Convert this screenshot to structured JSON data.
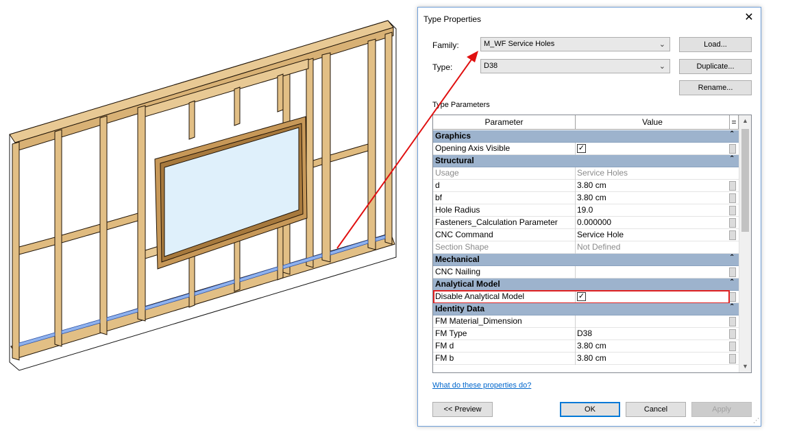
{
  "dialog": {
    "title": "Type Properties",
    "family_label": "Family:",
    "family_value": "M_WF Service Holes",
    "type_label": "Type:",
    "type_value": "D38",
    "load_button": "Load...",
    "duplicate_button": "Duplicate...",
    "rename_button": "Rename...",
    "type_parameters_label": "Type Parameters",
    "columns": {
      "parameter": "Parameter",
      "value": "Value",
      "eq": "="
    },
    "rows": [
      {
        "kind": "group",
        "name": "Graphics"
      },
      {
        "kind": "param",
        "name": "Opening Axis Visible",
        "checkbox": true,
        "checked": "✓"
      },
      {
        "kind": "group",
        "name": "Structural"
      },
      {
        "kind": "param",
        "name": "Usage",
        "value": "Service Holes",
        "gray": true
      },
      {
        "kind": "param",
        "name": "d",
        "value": "3.80 cm"
      },
      {
        "kind": "param",
        "name": "bf",
        "value": "3.80 cm"
      },
      {
        "kind": "param",
        "name": "Hole Radius",
        "value": "19.0"
      },
      {
        "kind": "param",
        "name": "Fasteners_Calculation Parameter",
        "value": "0.000000"
      },
      {
        "kind": "param",
        "name": "CNC Command",
        "value": "Service Hole"
      },
      {
        "kind": "param",
        "name": "Section Shape",
        "value": "Not Defined",
        "gray": true
      },
      {
        "kind": "group",
        "name": "Mechanical"
      },
      {
        "kind": "param",
        "name": "CNC Nailing",
        "value": ""
      },
      {
        "kind": "group",
        "name": "Analytical Model"
      },
      {
        "kind": "param",
        "name": "Disable Analytical Model",
        "checkbox": true,
        "checked": "✓",
        "highlight": true
      },
      {
        "kind": "group",
        "name": "Identity Data"
      },
      {
        "kind": "param",
        "name": "FM Material_Dimension",
        "value": ""
      },
      {
        "kind": "param",
        "name": "FM Type",
        "value": "D38"
      },
      {
        "kind": "param",
        "name": "FM d",
        "value": "3.80 cm"
      },
      {
        "kind": "param",
        "name": "FM b",
        "value": "3.80 cm"
      }
    ],
    "help_link": "What do these properties do?",
    "preview_button": "<< Preview",
    "ok_button": "OK",
    "cancel_button": "Cancel",
    "apply_button": "Apply",
    "icons": {
      "close": "close-icon",
      "dropdown": "chevron-down-icon",
      "collapse": "collapse-up-icon",
      "grip": "resize-grip-icon"
    }
  },
  "colors": {
    "group_header": "#9db3cd",
    "highlight_box": "#e02020",
    "arrow": "#e01010",
    "wood": "#e2bf85",
    "wood_dark": "#b98a4a",
    "service_hole": "#8fb2ee"
  }
}
